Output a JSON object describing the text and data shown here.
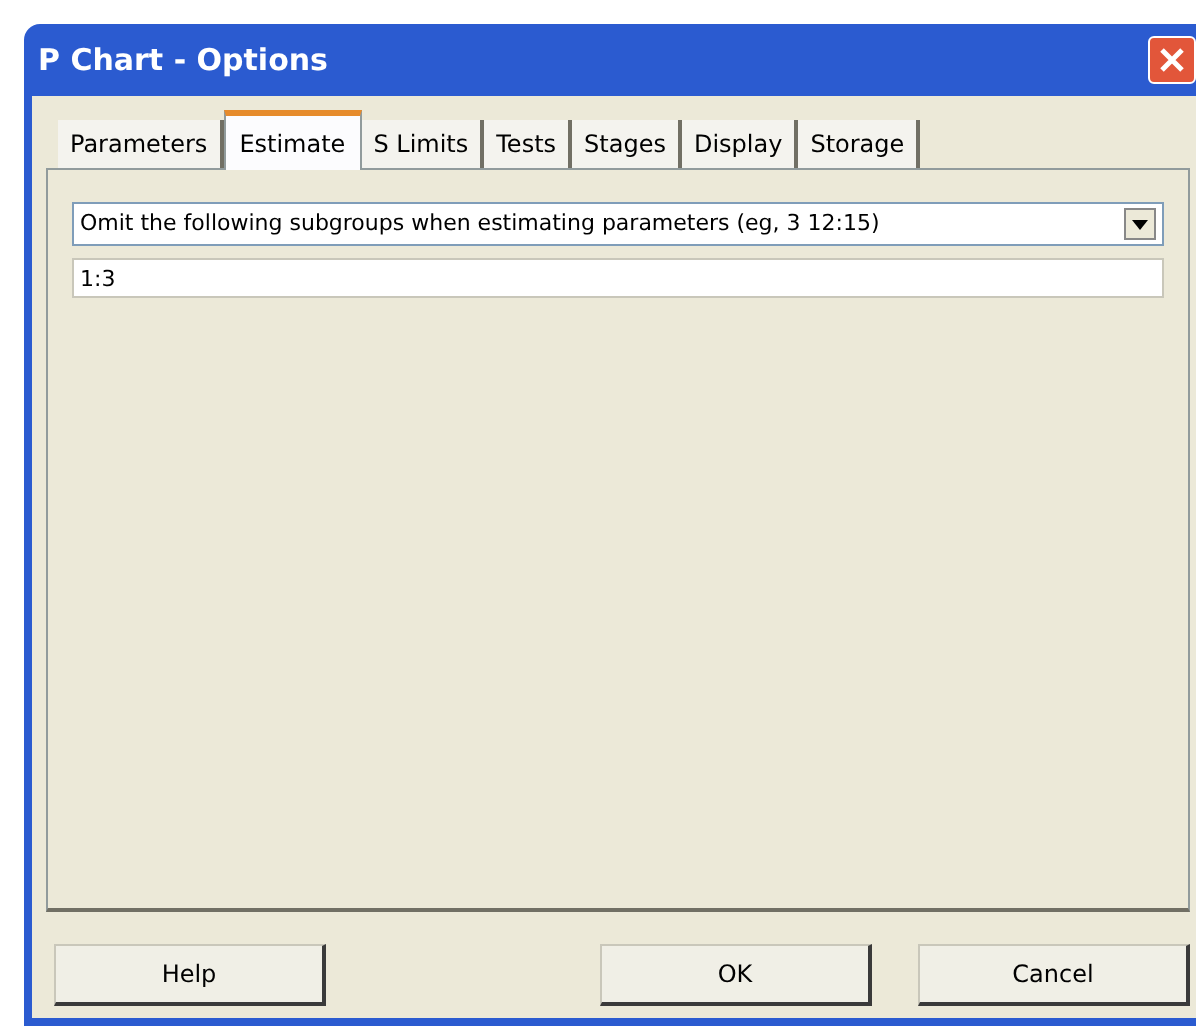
{
  "window": {
    "title": "P Chart - Options"
  },
  "tabs": [
    {
      "label": "Parameters",
      "selected": false
    },
    {
      "label": "Estimate",
      "selected": true
    },
    {
      "label": "S Limits",
      "selected": false
    },
    {
      "label": "Tests",
      "selected": false
    },
    {
      "label": "Stages",
      "selected": false
    },
    {
      "label": "Display",
      "selected": false
    },
    {
      "label": "Storage",
      "selected": false
    }
  ],
  "dropdown": {
    "value": "Omit the following subgroups when estimating parameters (eg, 3 12:15)"
  },
  "subgroups_field": {
    "value": "1:3"
  },
  "buttons": [
    {
      "label": "Help"
    },
    {
      "label": "OK"
    },
    {
      "label": "Cancel"
    }
  ]
}
